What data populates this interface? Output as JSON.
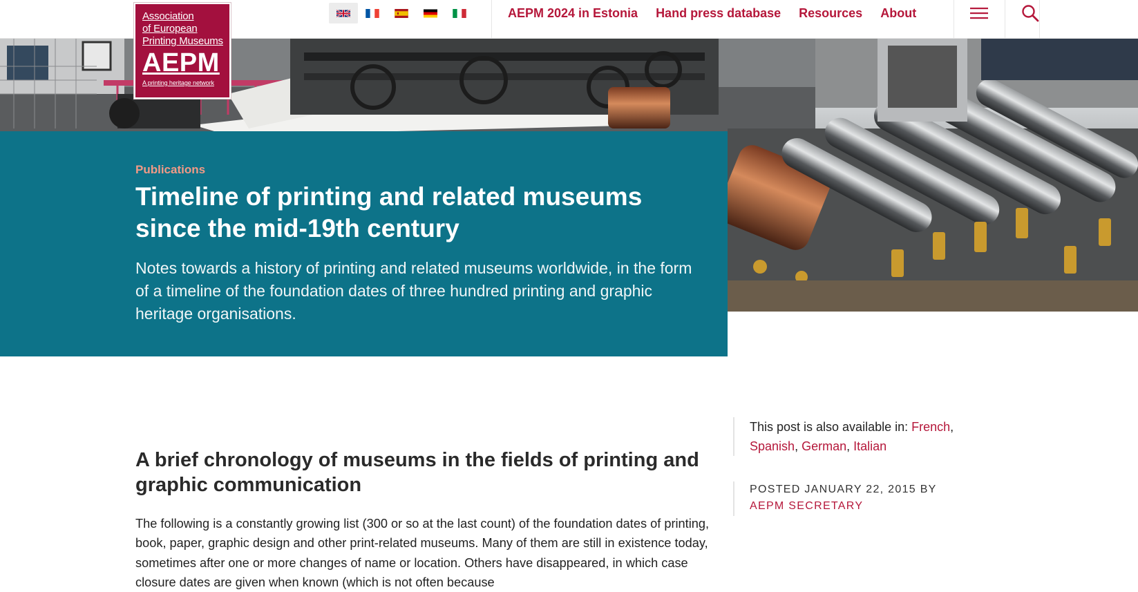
{
  "logo": {
    "line1": "Association",
    "line2": "of European",
    "line3": "Printing Museums",
    "acronym": "AEPM",
    "tagline": "A printing heritage network",
    "color": "#a3103e"
  },
  "languages": [
    {
      "name": "English",
      "icon": "uk-flag-icon",
      "active": true
    },
    {
      "name": "French",
      "icon": "french-flag-icon"
    },
    {
      "name": "Spanish",
      "icon": "spanish-flag-icon"
    },
    {
      "name": "German",
      "icon": "german-flag-icon"
    },
    {
      "name": "Italian",
      "icon": "italian-flag-icon"
    }
  ],
  "nav": {
    "items": [
      "AEPM 2024 in Estonia",
      "Hand press database",
      "Resources",
      "About"
    ],
    "menu_icon": "hamburger-menu-icon",
    "search_icon": "search-icon",
    "link_color": "#b5173a"
  },
  "hero": {
    "kicker": "Publications",
    "title": "Timeline of printing and related museums since the mid-19th century",
    "subtitle": "Notes towards a history of printing and related museums worldwide, in the form of a timeline of the foundation dates of three hundred printing and graphic heritage organisations.",
    "panel_color": "#0d7389",
    "kicker_color": "#f29a86"
  },
  "article": {
    "heading": "A brief chronology of museums in the fields of printing and graphic communication",
    "paragraph": "The following is a constantly growing list (300 or so at the last count) of the foundation dates of printing, book, paper, graphic design and other print-related museums. Many of them are still in existence today, sometimes after one or more changes of name or location. Others have disappeared, in which case closure dates are given when known (which is not often because"
  },
  "sidebar": {
    "available_prefix": "This post is also available in:",
    "languages": [
      "French",
      "Spanish",
      "German",
      "Italian"
    ],
    "posted": "Posted January 22, 2015 by",
    "author": "AEPM Secretary"
  }
}
